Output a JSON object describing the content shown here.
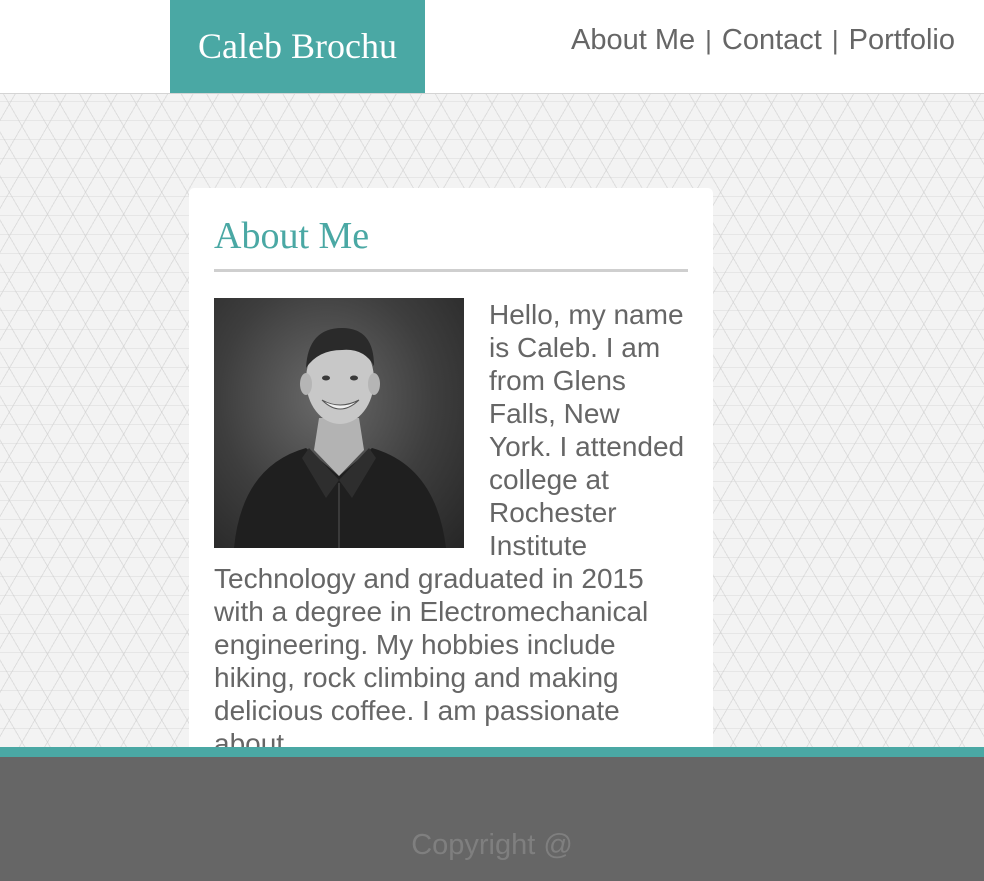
{
  "header": {
    "logo_text": "Caleb Brochu",
    "nav": {
      "about": "About Me",
      "contact": "Contact",
      "portfolio": "Portfolio",
      "separator": "|"
    }
  },
  "main": {
    "section_title": "About Me",
    "bio": "Hello, my name is Caleb. I am from Glens Falls, New York. I attended college at Rochester Institute Technology and graduated in 2015 with a degree in Electromechanical engineering. My hobbies include hiking, rock climbing and making delicious coffee. I am passionate about"
  },
  "footer": {
    "copyright": "Copyright @"
  },
  "colors": {
    "accent": "#4aa8a4",
    "text": "#666666",
    "footer_bg": "#666666",
    "footer_text": "#7f7f7f"
  }
}
